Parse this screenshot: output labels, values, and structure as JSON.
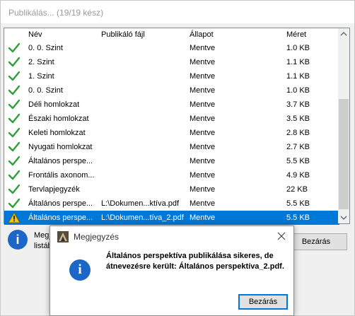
{
  "window": {
    "title": "Publikálás... (19/19 kész)"
  },
  "columns": {
    "name": "Név",
    "file": "Publikáló fájl",
    "state": "Állapot",
    "size": "Méret"
  },
  "rows": [
    {
      "name": "0. 0. Szint",
      "file": "",
      "state": "Mentve",
      "size": "1.0 KB",
      "status_icon": "check-icon"
    },
    {
      "name": "2. Szint",
      "file": "",
      "state": "Mentve",
      "size": "1.1 KB",
      "status_icon": "check-icon"
    },
    {
      "name": "1. Szint",
      "file": "",
      "state": "Mentve",
      "size": "1.1 KB",
      "status_icon": "check-icon"
    },
    {
      "name": "0. 0. Szint",
      "file": "",
      "state": "Mentve",
      "size": "1.0 KB",
      "status_icon": "check-icon"
    },
    {
      "name": "Déli homlokzat",
      "file": "",
      "state": "Mentve",
      "size": "3.7 KB",
      "status_icon": "check-icon"
    },
    {
      "name": "Északi homlokzat",
      "file": "",
      "state": "Mentve",
      "size": "3.5 KB",
      "status_icon": "check-icon"
    },
    {
      "name": "Keleti homlokzat",
      "file": "",
      "state": "Mentve",
      "size": "2.8 KB",
      "status_icon": "check-icon"
    },
    {
      "name": "Nyugati homlokzat",
      "file": "",
      "state": "Mentve",
      "size": "2.7 KB",
      "status_icon": "check-icon"
    },
    {
      "name": "Általános perspe...",
      "file": "",
      "state": "Mentve",
      "size": "5.5 KB",
      "status_icon": "check-icon"
    },
    {
      "name": "Frontális axonom...",
      "file": "",
      "state": "Mentve",
      "size": "4.9 KB",
      "status_icon": "check-icon"
    },
    {
      "name": "Tervlapjegyzék",
      "file": "",
      "state": "Mentve",
      "size": "22 KB",
      "status_icon": "check-icon"
    },
    {
      "name": "Általános perspe...",
      "file": "L:\\Dokumen...ktíva.pdf",
      "state": "Mentve",
      "size": "5.5 KB",
      "status_icon": "check-icon"
    },
    {
      "name": "Általános perspe...",
      "file": "L:\\Dokumen...tíva_2.pdf",
      "state": "Mentve",
      "size": "5.5 KB",
      "status_icon": "warning-icon",
      "selected": true
    }
  ],
  "info_area": {
    "text_line1": "Megjegyzés",
    "text_line2": "listában"
  },
  "main_close_label": "Bezárás",
  "dialog": {
    "title": "Megjegyzés",
    "message": "Általános perspektíva publikálása sikeres, de átnevezésre került: Általános perspektíva_2.pdf.",
    "button_label": "Bezárás"
  },
  "colors": {
    "selection": "#0078d7",
    "check": "#2e9e3a",
    "info_blue": "#1c66c8",
    "warning": "#f2c40f"
  }
}
